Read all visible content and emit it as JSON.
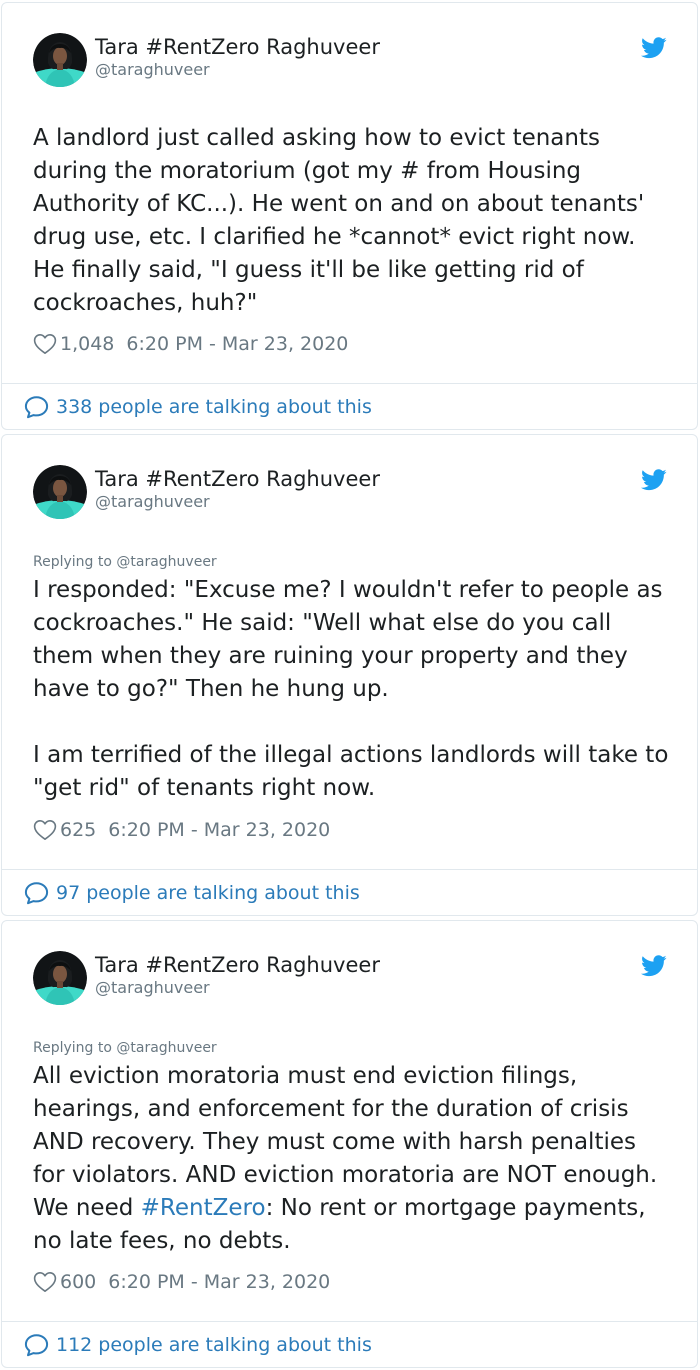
{
  "tweets": [
    {
      "author": {
        "name": "Tara #RentZero Raghuveer",
        "handle": "@taraghuveer"
      },
      "reply_to": "",
      "text": "A landlord just called asking how to evict tenants during the moratorium (got my # from Housing Authority of KC...). He went on and on about tenants' drug use, etc. I clarified he *cannot* evict right now. He finally said, \"I guess it'll be like getting rid of cockroaches, huh?\"",
      "likes": "1,048",
      "timestamp": "6:20 PM - Mar 23, 2020",
      "talking": "338 people are talking about this"
    },
    {
      "author": {
        "name": "Tara #RentZero Raghuveer",
        "handle": "@taraghuveer"
      },
      "reply_to": "Replying to @taraghuveer",
      "text": "I responded: \"Excuse me? I wouldn't refer to people as cockroaches.\" He said: \"Well what else do you call them when they are ruining your property and they have to go?\" Then he hung up.\n\nI am terrified of the illegal actions landlords will take to \"get rid\" of tenants right now.",
      "likes": "625",
      "timestamp": "6:20 PM - Mar 23, 2020",
      "talking": "97 people are talking about this"
    },
    {
      "author": {
        "name": "Tara #RentZero Raghuveer",
        "handle": "@taraghuveer"
      },
      "reply_to": "Replying to @taraghuveer",
      "text_before": "All eviction moratoria must end eviction filings, hearings, and enforcement for the duration of crisis AND recovery. They must come with harsh penalties for violators. AND eviction moratoria are NOT enough. We need ",
      "hashtag": "#RentZero",
      "text_after": ": No rent or mortgage payments, no late fees, no debts.",
      "likes": "600",
      "timestamp": "6:20 PM - Mar 23, 2020",
      "talking": "112 people are talking about this"
    }
  ],
  "icons": {
    "like": "heart-outline-icon",
    "talking": "speech-bubble-icon",
    "brand": "twitter-bird-icon"
  },
  "colors": {
    "link": "#2b7bb9",
    "brand": "#1da1f2",
    "muted": "#697882",
    "text": "#1c2022",
    "border": "#e1e8ed"
  }
}
